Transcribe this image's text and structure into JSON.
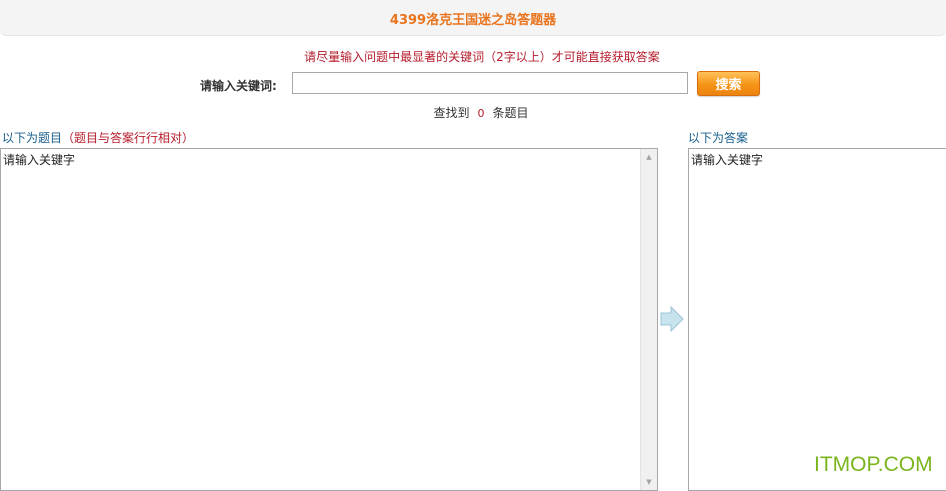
{
  "header": {
    "title": "4399洛克王国迷之岛答题器"
  },
  "hint": "请尽量输入问题中最显著的关键词（2字以上）才可能直接获取答案",
  "search": {
    "label": "请输入关键词:",
    "value": "",
    "button_label": "搜索"
  },
  "result": {
    "prefix": "查找到",
    "count": "0",
    "suffix": "条题目"
  },
  "questions": {
    "label": "以下为题目",
    "sublabel": "（题目与答案行行相对）",
    "content": "请输入关键字"
  },
  "answers": {
    "label": "以下为答案",
    "content": "请输入关键字"
  },
  "icons": {
    "arrow": "arrow-right-icon",
    "scroll_up": "scroll-up-icon",
    "scroll_down": "scroll-down-icon"
  },
  "watermark": "ITMOP.COM",
  "colors": {
    "title": "#e8741e",
    "hint": "#b51c2c",
    "button": "#f59417",
    "label_blue": "#1a5f8e",
    "watermark": "#7ab51d"
  }
}
